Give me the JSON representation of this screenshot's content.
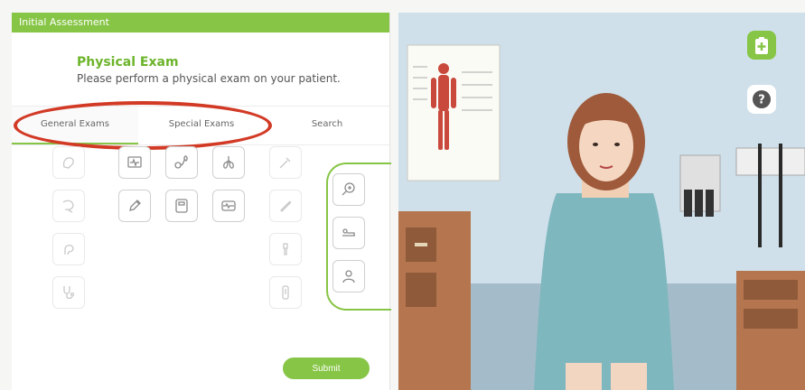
{
  "header": {
    "title": "Initial Assessment"
  },
  "exam": {
    "title": "Physical Exam",
    "subtitle": "Please perform a physical exam on your patient."
  },
  "tabs": [
    {
      "label": "General Exams",
      "active": true
    },
    {
      "label": "Special Exams",
      "active": false
    },
    {
      "label": "Search",
      "active": false
    }
  ],
  "tools": {
    "left_column": [
      "head-icon",
      "neck-icon",
      "face-icon",
      "stethoscope-icon"
    ],
    "grid_row1": [
      "heart-monitor-icon",
      "blood-pressure-icon",
      "lungs-icon"
    ],
    "grid_row2": [
      "pencil-icon",
      "scale-icon",
      "ecg-icon"
    ],
    "right_column": [
      "reflex-hammer-icon",
      "tongue-depressor-icon",
      "otoscope-icon",
      "thermometer-icon"
    ],
    "side_panel": [
      "magnify-icon",
      "lying-patient-icon",
      "person-icon"
    ]
  },
  "actions": {
    "submit_label": "Submit"
  },
  "scene_controls": {
    "clipboard_icon": "clipboard-plus-icon",
    "help_icon": "help-icon",
    "help_symbol": "?"
  },
  "colors": {
    "accent": "#86c545",
    "highlight": "#d23a26",
    "wall": "#cfe0ea"
  }
}
